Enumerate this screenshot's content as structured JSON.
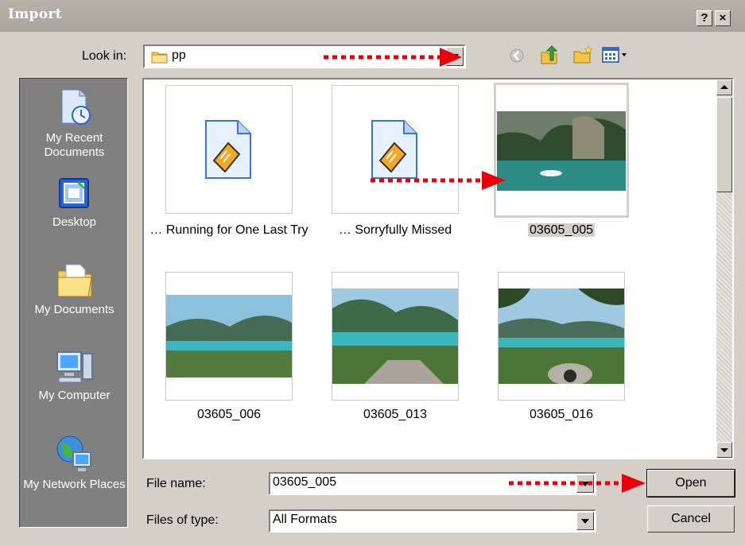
{
  "window": {
    "title": "Import",
    "help_label": "?",
    "close_label": "×"
  },
  "look_in": {
    "label": "Look in:",
    "value": "pp",
    "folder_icon": "folder-icon"
  },
  "toolbar": {
    "icons": [
      "back-icon",
      "up-folder-icon",
      "new-folder-icon",
      "view-menu-icon"
    ]
  },
  "places": [
    {
      "label": "My Recent Documents",
      "icon": "recent-documents-icon"
    },
    {
      "label": "Desktop",
      "icon": "desktop-icon"
    },
    {
      "label": "My Documents",
      "icon": "my-documents-icon"
    },
    {
      "label": "My Computer",
      "icon": "my-computer-icon"
    },
    {
      "label": "My Network Places",
      "icon": "network-places-icon"
    }
  ],
  "files": [
    {
      "name": "… Running for One Last Try",
      "type": "audio-file"
    },
    {
      "name": "… Sorryfully Missed",
      "type": "audio-file"
    },
    {
      "name": "03605_005",
      "type": "image",
      "selected": true
    },
    {
      "name": "03605_006",
      "type": "image"
    },
    {
      "name": "03605_013",
      "type": "image"
    },
    {
      "name": "03605_016",
      "type": "image"
    }
  ],
  "file_name": {
    "label": "File name:",
    "value": "03605_005"
  },
  "file_type": {
    "label": "Files of type:",
    "value": "All Formats"
  },
  "buttons": {
    "open": "Open",
    "cancel": "Cancel"
  },
  "annotation_color": "#e8000b"
}
